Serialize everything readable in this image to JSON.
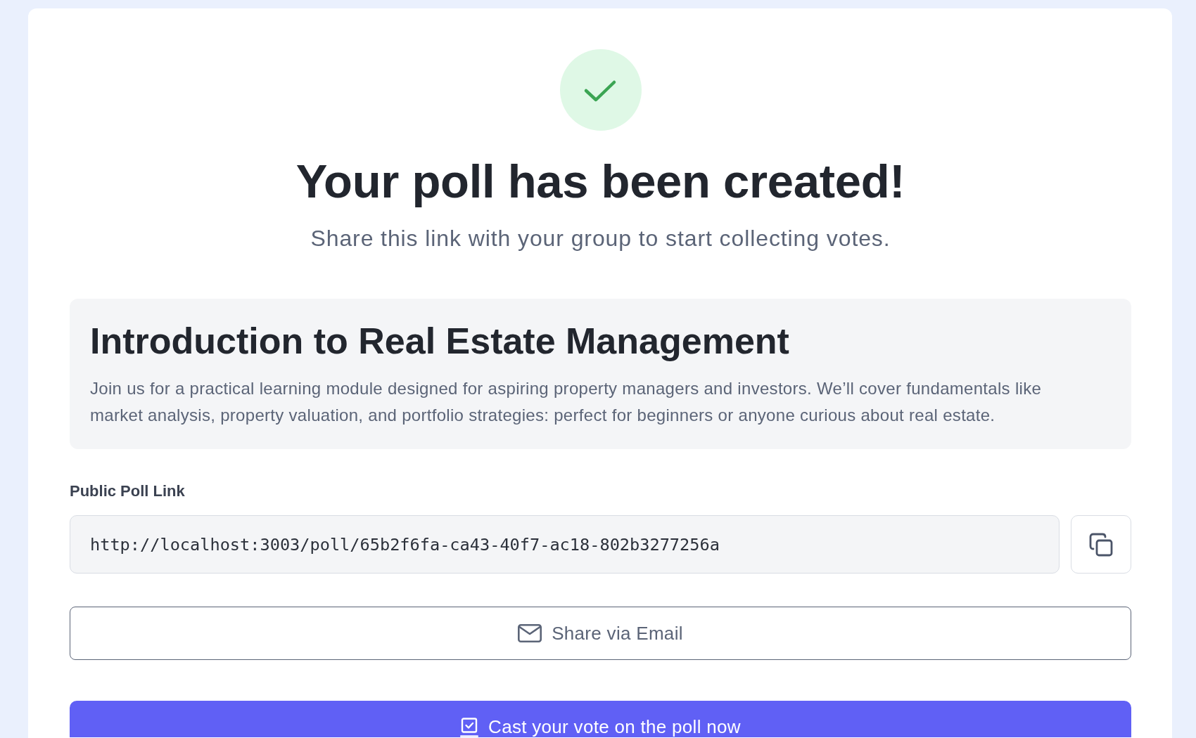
{
  "heading": "Your poll has been created!",
  "subheading": "Share this link with your group to start collecting votes.",
  "poll": {
    "title": "Introduction to Real Estate Management",
    "description": "Join us for a practical learning module designed for aspiring property managers and investors. We’ll cover fundamentals like market analysis, property valuation, and portfolio strategies: perfect for beginners or anyone curious about real estate."
  },
  "link": {
    "label": "Public Poll Link",
    "value": "http://localhost:3003/poll/65b2f6fa-ca43-40f7-ac18-802b3277256a"
  },
  "buttons": [
    {
      "kind": "outline",
      "label": "Share via Email"
    },
    {
      "kind": "primary",
      "label": "Cast your vote on the poll now"
    }
  ]
}
